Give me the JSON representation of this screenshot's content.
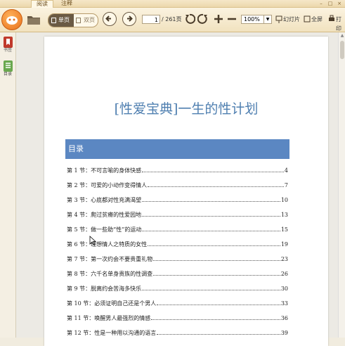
{
  "tabs": [
    {
      "label": "阅读",
      "active": true
    },
    {
      "label": "注释",
      "active": false
    }
  ],
  "toolbar": {
    "single_page_label": "单页",
    "double_page_label": "双页",
    "current_page": "1",
    "total_pages": "/ 261页",
    "zoom_value": "100%",
    "zoom_dropdown": "▼",
    "slideshow_label": "幻灯片",
    "fullscreen_label": "全屏",
    "print_label": "打印"
  },
  "sidebar": {
    "items": [
      {
        "label": "书签",
        "icon": "bookmark-icon",
        "color": "#c0392b"
      },
      {
        "label": "目录",
        "icon": "outline-icon",
        "color": "#6aa84f"
      }
    ]
  },
  "document": {
    "title": "[性爱宝典]一生的性计划",
    "toc_heading": "目录",
    "toc": [
      {
        "text": "第 1 节：不可言喻的身体快感",
        "page": "4"
      },
      {
        "text": "第 2 节：可爱的小动作变得情人",
        "page": "7"
      },
      {
        "text": "第 3 节：心底都对性充满渴望",
        "page": "10"
      },
      {
        "text": "第 4 节：爬过贫瘠的性爱园地",
        "page": "13"
      },
      {
        "text": "第 5 节：做一些助“性”的运动",
        "page": "15"
      },
      {
        "text": "第 6 节：理想情人之特质的女性",
        "page": "19"
      },
      {
        "text": "第 7 节：第一次约会不要贵重礼物",
        "page": "23"
      },
      {
        "text": "第 8 节：六千名单身贵族的性调查",
        "page": "26"
      },
      {
        "text": "第 9 节：脱离约会苦海多快乐",
        "page": "30"
      },
      {
        "text": "第 10 节：必须证明自己还是个男人",
        "page": "33"
      },
      {
        "text": "第 11 节：唤醒男人最强烈的情感",
        "page": "36"
      },
      {
        "text": "第 12 节：性是一种用以沟通的语言",
        "page": "39"
      }
    ]
  },
  "colors": {
    "accent": "#5b87c2",
    "title": "#4f7fb0",
    "toolbar": "#f1e2bf"
  }
}
